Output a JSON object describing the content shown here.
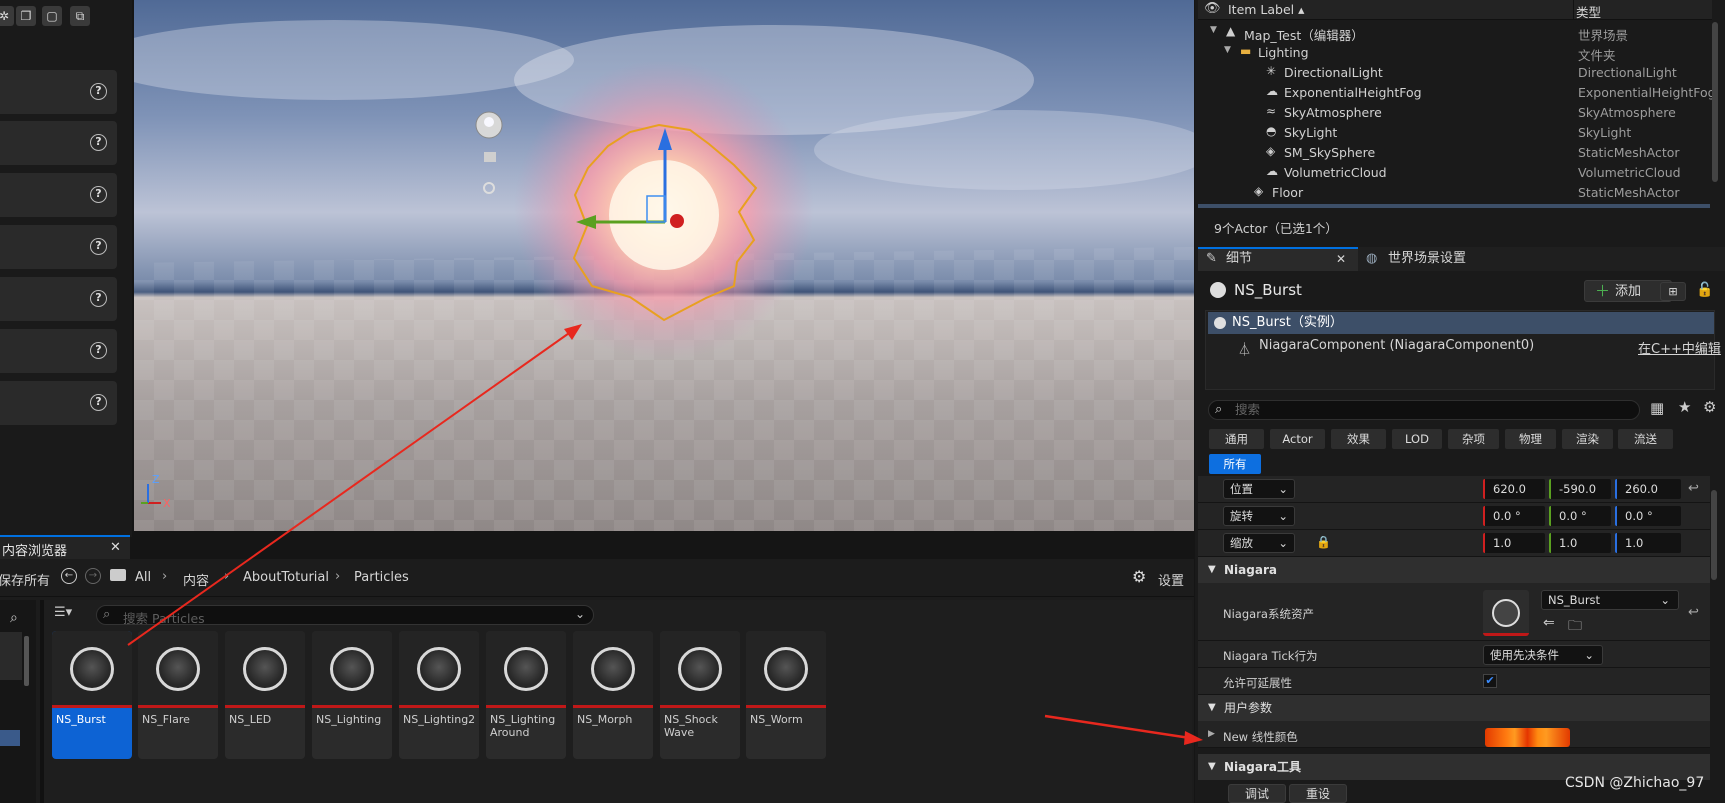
{
  "left_panel": {
    "toolbar_icons": [
      "sparkle-icon",
      "copy-actor-icon",
      "frame-icon",
      "layers-icon"
    ],
    "help_rows": 7
  },
  "content_browser": {
    "tab_title": "内容浏览器",
    "save_all": "保存所有",
    "breadcrumb": [
      "All",
      "内容",
      "AboutToturial",
      "Particles"
    ],
    "settings_label": "设置",
    "search_placeholder": "搜索 Particles",
    "assets": [
      {
        "name": "NS_Burst",
        "selected": true
      },
      {
        "name": "NS_Flare"
      },
      {
        "name": "NS_LED"
      },
      {
        "name": "NS_Lighting"
      },
      {
        "name": "NS_Lighting2"
      },
      {
        "name": "NS_Lighting Around"
      },
      {
        "name": "NS_Morph"
      },
      {
        "name": "NS_Shock Wave"
      },
      {
        "name": "NS_Worm"
      }
    ]
  },
  "viewport": {
    "axis": {
      "z": "Z",
      "x": "X"
    }
  },
  "outliner": {
    "col_label": "Item Label ▴",
    "col_type": "类型",
    "rows": [
      {
        "label": "Map_Test（编辑器）",
        "type": "世界场景"
      },
      {
        "label": "Lighting",
        "type": "文件夹"
      },
      {
        "label": "DirectionalLight",
        "type": "DirectionalLight"
      },
      {
        "label": "ExponentialHeightFog",
        "type": "ExponentialHeightFog"
      },
      {
        "label": "SkyAtmosphere",
        "type": "SkyAtmosphere"
      },
      {
        "label": "SkyLight",
        "type": "SkyLight"
      },
      {
        "label": "SM_SkySphere",
        "type": "StaticMeshActor"
      },
      {
        "label": "VolumetricCloud",
        "type": "VolumetricCloud"
      },
      {
        "label": "Floor",
        "type": "StaticMeshActor"
      }
    ],
    "status": "9个Actor（已选1个）"
  },
  "details": {
    "tab_details": "细节",
    "tab_world": "世界场景设置",
    "actor_name": "NS_Burst",
    "add_label": "添加",
    "instance_label": "NS_Burst（实例）",
    "component_label": "NiagaraComponent (NiagaraComponent0)",
    "edit_cpp": "在C++中编辑",
    "search_placeholder": "搜索",
    "filters": [
      "通用",
      "Actor",
      "效果",
      "LOD",
      "杂项",
      "物理",
      "渲染",
      "流送"
    ],
    "filter_all": "所有",
    "transform": {
      "location_label": "位置",
      "location": [
        "620.0",
        "-590.0",
        "260.0"
      ],
      "rotation_label": "旋转",
      "rotation": [
        "0.0 °",
        "0.0 °",
        "0.0 °"
      ],
      "scale_label": "缩放",
      "scale": [
        "1.0",
        "1.0",
        "1.0"
      ]
    },
    "niagara_section": "Niagara",
    "niagara_asset_label": "Niagara系统资产",
    "niagara_asset_value": "NS_Burst",
    "tick_label": "Niagara Tick行为",
    "tick_value": "使用先决条件",
    "scalability_label": "允许可延展性",
    "user_params_section": "用户参数",
    "linear_color_label": "New 线性颜色",
    "tools_section": "Niagara工具",
    "debug_btn": "调试",
    "reset_btn": "重设"
  },
  "watermark": "CSDN @Zhichao_97",
  "colors": {
    "accent": "#0d63d4",
    "selection_outline": "#e8a020",
    "arrow": "#e8281e",
    "swatch": "#ff5a10"
  }
}
